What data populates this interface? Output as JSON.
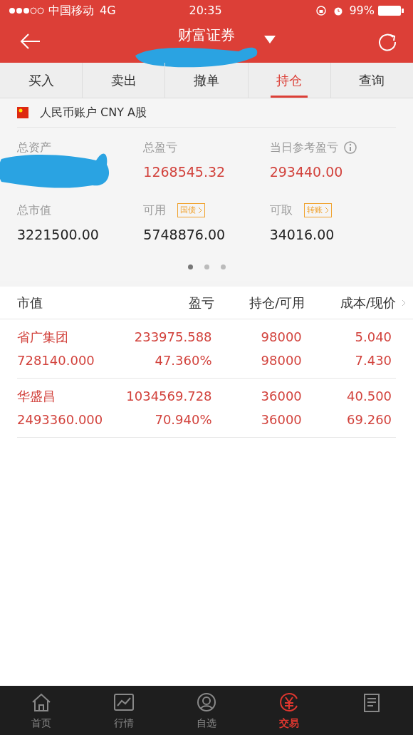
{
  "status_bar": {
    "carrier": "中国移动",
    "network": "4G",
    "time": "20:35",
    "battery": "99%"
  },
  "header": {
    "title": "财富证券",
    "subtitle_redacted": true
  },
  "tabs": [
    {
      "label": "买入",
      "selected": false
    },
    {
      "label": "卖出",
      "selected": false
    },
    {
      "label": "撤单",
      "selected": false
    },
    {
      "label": "持仓",
      "selected": true
    },
    {
      "label": "查询",
      "selected": false
    }
  ],
  "account": {
    "name": "人民币账户 CNY A股"
  },
  "summary": [
    {
      "label": "总资产",
      "redacted": true
    },
    {
      "label": "总盈亏",
      "value": "1268545.32"
    },
    {
      "label": "当日参考盈亏",
      "value": "293440.00",
      "info": true
    },
    {
      "label": "总市值",
      "value": "3221500.00"
    },
    {
      "label": "可用",
      "value": "5748876.00",
      "tag": "国债"
    },
    {
      "label": "可取",
      "value": "34016.00",
      "tag": "转账"
    }
  ],
  "pager": [
    {
      "selected": true
    },
    {
      "selected": false
    },
    {
      "selected": false
    }
  ],
  "table": {
    "columns": [
      "市值",
      "盈亏",
      "持仓/可用",
      "成本/现价"
    ],
    "rows": [
      {
        "cells": [
          [
            "省广集团",
            "728140.000"
          ],
          [
            "233975.588",
            "47.360%"
          ],
          [
            "98000",
            "98000"
          ],
          [
            "5.040",
            "7.430"
          ]
        ]
      },
      {
        "cells": [
          [
            "华盛昌",
            "2493360.000"
          ],
          [
            "1034569.728",
            "70.940%"
          ],
          [
            "36000",
            "36000"
          ],
          [
            "40.500",
            "69.260"
          ]
        ]
      }
    ]
  },
  "bottom_nav": [
    {
      "label": "首页",
      "selected": false
    },
    {
      "label": "行情",
      "selected": false
    },
    {
      "label": "自选",
      "selected": false
    },
    {
      "label": "交易",
      "selected": true
    },
    {
      "selected": false
    }
  ]
}
